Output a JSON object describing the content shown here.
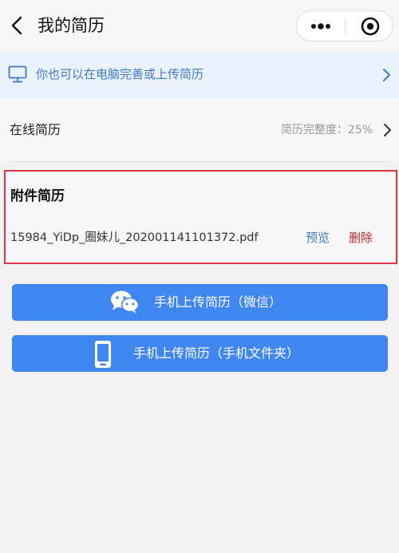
{
  "header": {
    "title": "我的简历",
    "back_icon": "chevron-left-icon",
    "more_icon": "more-dots-icon",
    "close_icon": "target-circle-icon"
  },
  "banner": {
    "text": "你也可以在电脑完善或上传简历",
    "icon": "monitor-icon",
    "color": "#3e7ac6"
  },
  "online_resume": {
    "label": "在线简历",
    "completeness": "简历完整度：25%"
  },
  "attachment": {
    "heading": "附件简历",
    "filename": "15984_YiDp_圈妹儿_202001141101372.pdf",
    "preview": "预览",
    "delete": "删除",
    "highlight_color": "#d9363e"
  },
  "buttons": {
    "wechat_upload": "手机上传简历（微信）",
    "phone_upload": "手机上传简历（手机文件夹）",
    "color": "#3f86f0"
  }
}
